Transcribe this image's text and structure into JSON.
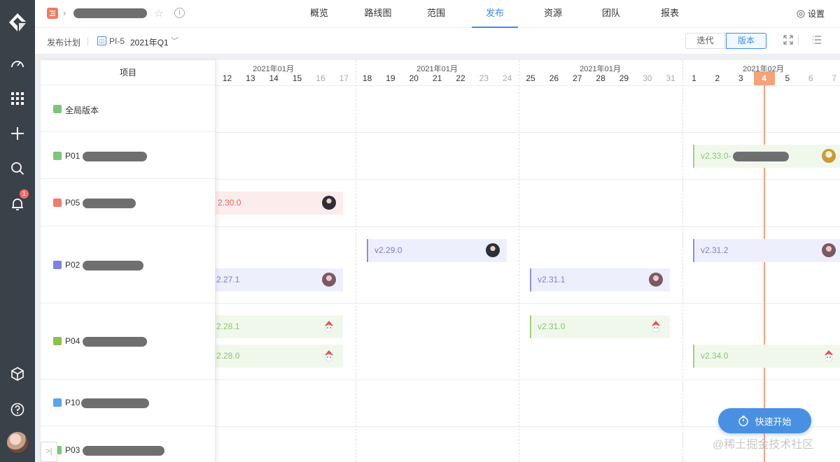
{
  "nav": {
    "tabs": [
      {
        "label": "概览"
      },
      {
        "label": "路线图"
      },
      {
        "label": "范围"
      },
      {
        "label": "发布"
      },
      {
        "label": "资源"
      },
      {
        "label": "团队"
      },
      {
        "label": "报表"
      }
    ],
    "active_tab": "发布",
    "settings_label": "设置"
  },
  "sidebar": {
    "icons": [
      "logo-icon",
      "dashboard-icon",
      "apps-icon",
      "add-icon",
      "search-icon",
      "bell-icon",
      "cube-icon",
      "help-icon"
    ],
    "notification_count": "1"
  },
  "toolbar": {
    "title": "发布计划",
    "pi_label": "PI-5",
    "quarter": "2021年Q1",
    "view_iteration": "迭代",
    "view_version": "版本",
    "active_view": "版本"
  },
  "panel": {
    "header": "项目",
    "rows": [
      {
        "label": "全局版本",
        "icon_color": "#7bc67b"
      },
      {
        "label": "P01",
        "icon_color": "#7bc67b"
      },
      {
        "label": "P05",
        "icon_color": "#ef7d6e"
      },
      {
        "label": "P02",
        "icon_color": "#7c83e0"
      },
      {
        "label": "P04",
        "icon_color": "#8bc34a"
      },
      {
        "label": "P10",
        "icon_color": "#5aa4e8"
      },
      {
        "label": "P03",
        "icon_color": "#7bc67b"
      }
    ]
  },
  "timeline": {
    "months": [
      "2021年01月",
      "2021年01月",
      "2021年01月",
      "2021年02月"
    ],
    "days": [
      "12",
      "13",
      "14",
      "15",
      "16",
      "17",
      "18",
      "19",
      "20",
      "21",
      "22",
      "23",
      "24",
      "25",
      "26",
      "27",
      "28",
      "29",
      "30",
      "31",
      "1",
      "2",
      "3",
      "4",
      "5",
      "6",
      "7"
    ],
    "weekend_days": [
      "16",
      "17",
      "23",
      "24",
      "30",
      "31",
      "6",
      "7"
    ],
    "today": "4"
  },
  "releases": [
    {
      "project": "P01",
      "label": "v2.33.0-",
      "color": "green"
    },
    {
      "project": "P05",
      "label": "2.30.0",
      "color": "red"
    },
    {
      "project": "P02",
      "label": "v2.29.0",
      "color": "purple"
    },
    {
      "project": "P02",
      "label": "v2.31.2",
      "color": "purple"
    },
    {
      "project": "P02",
      "label": "2.27.1",
      "color": "purple"
    },
    {
      "project": "P02",
      "label": "v2.31.1",
      "color": "purple"
    },
    {
      "project": "P04",
      "label": "2.28.1",
      "color": "green"
    },
    {
      "project": "P04",
      "label": "v2.31.0",
      "color": "green"
    },
    {
      "project": "P04",
      "label": "2.28.0",
      "color": "green"
    },
    {
      "project": "P04",
      "label": "v2.34.0",
      "color": "green"
    }
  ],
  "quick_start": "快速开始",
  "watermark": "@稀土掘金技术社区",
  "colors": {
    "accent": "#3b8ced",
    "today": "#f5a27a",
    "sidebar": "#3a4249"
  }
}
